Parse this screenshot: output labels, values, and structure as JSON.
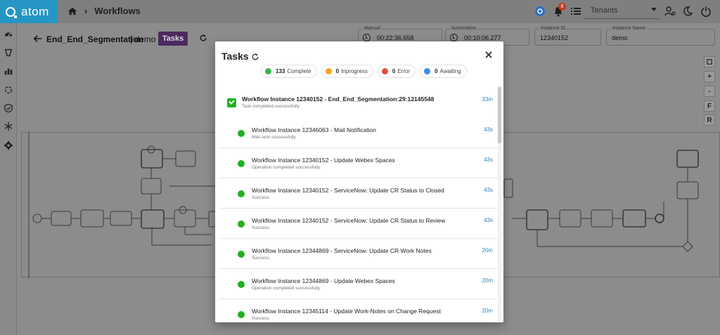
{
  "header": {
    "app_name": "atom",
    "breadcrumb": "Workflows",
    "notification_count": "8",
    "tenants_placeholder": "Tenants"
  },
  "workflow": {
    "title": "End_End_Segmentation",
    "tenant": "| demo",
    "tasks_button": "Tasks"
  },
  "fields": {
    "manual_label": "Manual",
    "manual_value": "00:22:36.658",
    "automation_label": "Automation",
    "automation_value": "00:10:06.277",
    "instance_id_label": "Instance ID",
    "instance_id_value": "12340152",
    "instance_name_label": "Instance Name",
    "instance_name_value": "demo"
  },
  "tools": [
    "+",
    "-",
    "F",
    "R"
  ],
  "modal": {
    "title": "Tasks",
    "chips": [
      {
        "count": "133",
        "label": "Complete",
        "color": "#3cb44b"
      },
      {
        "count": "0",
        "label": "Inprogress",
        "color": "#f5a623"
      },
      {
        "count": "0",
        "label": "Error",
        "color": "#e84c3d"
      },
      {
        "count": "0",
        "label": "Awaiting",
        "color": "#3d8ee8"
      }
    ],
    "tasks": [
      {
        "title": "Workflow Instance 12340152 - End_End_Segmentation:29:12145548",
        "subtitle": "Task completed successfully",
        "time": "33m"
      },
      {
        "title": "Workflow Instance 12346063 - Mail Notification",
        "subtitle": "Mail sent successfully",
        "time": "43s"
      },
      {
        "title": "Workflow Instance 12340152 - Update Webex Spaces",
        "subtitle": "Operation completed successfully",
        "time": "43s"
      },
      {
        "title": "Workflow Instance 12340152 - ServiceNow: Update CR Status to Closed",
        "subtitle": "Success.",
        "time": "43s"
      },
      {
        "title": "Workflow Instance 12340152 - ServiceNow: Update CR Status to Review",
        "subtitle": "Success.",
        "time": "43s"
      },
      {
        "title": "Workflow Instance 12344869 - ServiceNow: Update CR Work Notes",
        "subtitle": "Success.",
        "time": "20m"
      },
      {
        "title": "Workflow Instance 12344869 - Update Webex Spaces",
        "subtitle": "Operation completed successfully",
        "time": "20m"
      },
      {
        "title": "Workflow Instance 12345114 - Update Work-Notes on Change Request",
        "subtitle": "Success.",
        "time": "20m"
      }
    ]
  }
}
